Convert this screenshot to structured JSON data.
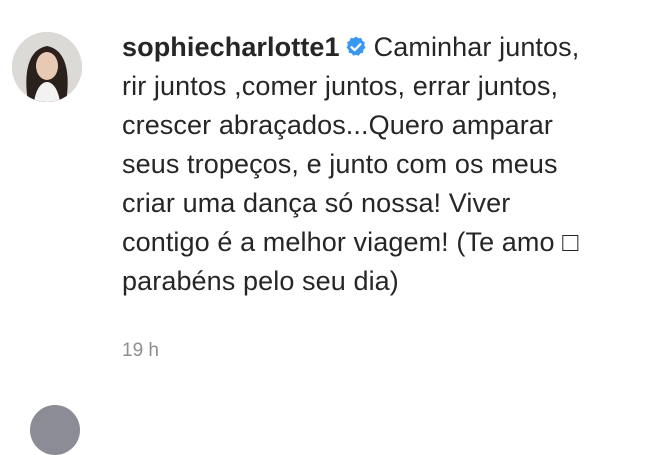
{
  "comment": {
    "username": "sophiecharlotte1",
    "verified": true,
    "verified_icon": "verified-badge-icon",
    "text": "Caminhar juntos,\nrir juntos ,comer juntos, errar juntos,\ncrescer abraçados...Quero amparar\nseus tropeços, e junto com os meus\ncriar uma dança só nossa! Viver\ncontigo é a melhor viagem! (Te amo □\nparabéns pelo seu dia)",
    "timestamp": "19 h"
  },
  "colors": {
    "verified_blue": "#3897f0",
    "text": "#262626",
    "muted": "#8e8e8e"
  }
}
